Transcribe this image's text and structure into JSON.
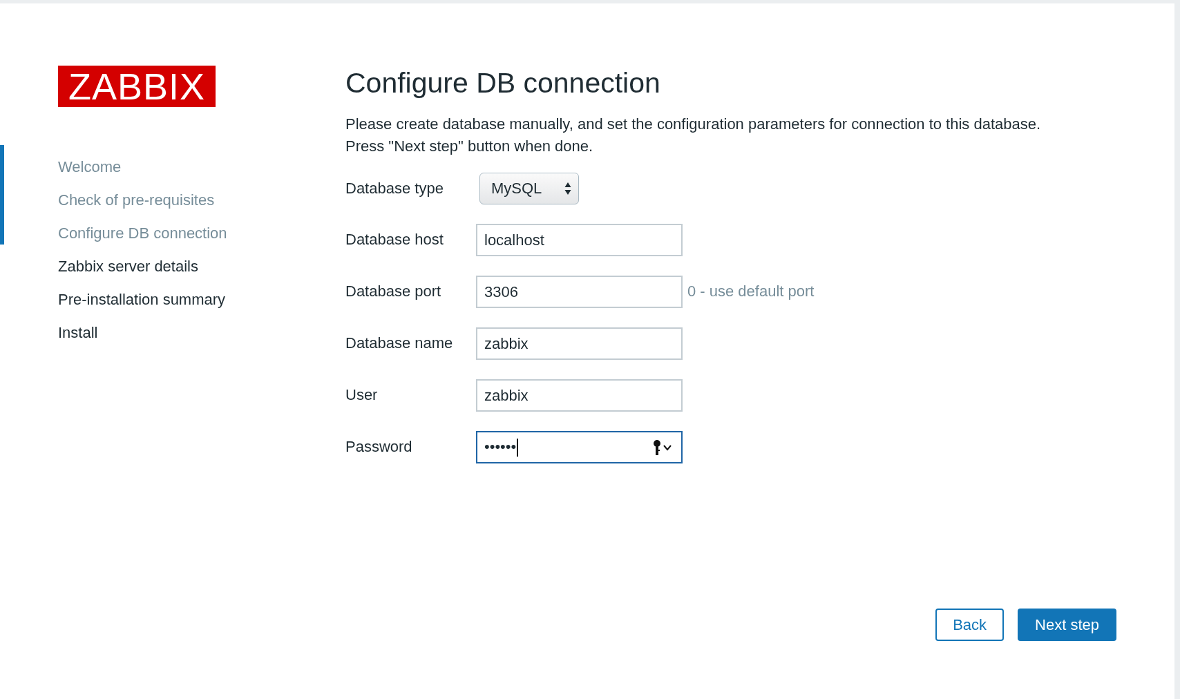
{
  "logo": "ZABBIX",
  "steps": [
    {
      "label": "Welcome",
      "done": true
    },
    {
      "label": "Check of pre-requisites",
      "done": true
    },
    {
      "label": "Configure DB connection",
      "done": true
    },
    {
      "label": "Zabbix server details",
      "done": false
    },
    {
      "label": "Pre-installation summary",
      "done": false
    },
    {
      "label": "Install",
      "done": false
    }
  ],
  "title": "Configure DB connection",
  "description": [
    "Please create database manually, and set the configuration parameters for connection to this database.",
    "Press \"Next step\" button when done."
  ],
  "fields": [
    {
      "kind": "select",
      "label": "Database type",
      "value": "MySQL"
    },
    {
      "kind": "text",
      "label": "Database host",
      "value": "localhost",
      "focused": false
    },
    {
      "kind": "text",
      "label": "Database port",
      "value": "3306",
      "hint": "0 - use default port",
      "focused": false
    },
    {
      "kind": "text",
      "label": "Database name",
      "value": "zabbix",
      "focused": false
    },
    {
      "kind": "text",
      "label": "User",
      "value": "zabbix",
      "focused": false
    },
    {
      "kind": "password",
      "label": "Password",
      "value": "••••••",
      "focused": true
    }
  ],
  "buttons": [
    {
      "label": "Back",
      "primary": false
    },
    {
      "label": "Next step",
      "primary": true
    }
  ]
}
